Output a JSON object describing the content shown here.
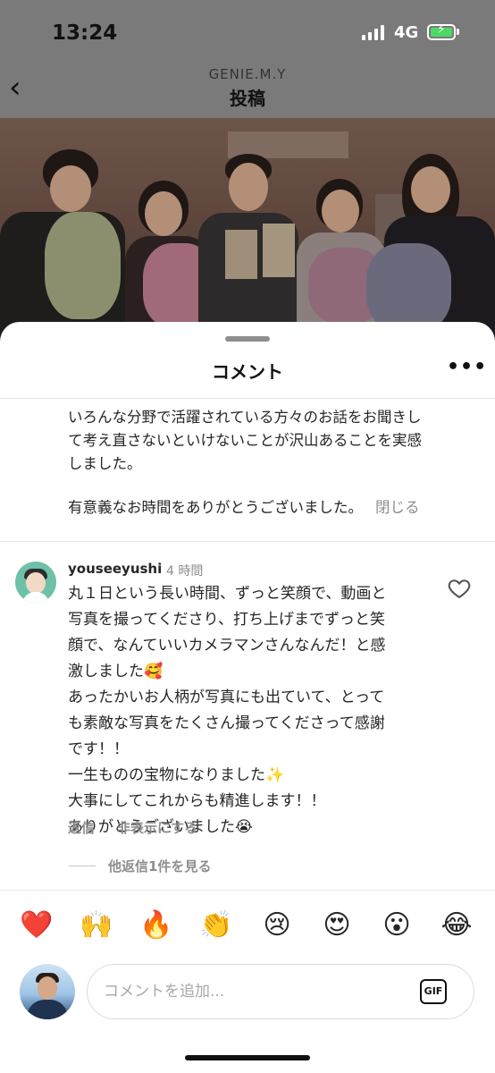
{
  "status": {
    "time": "13:24",
    "network": "4G"
  },
  "header": {
    "account": "GENIE.M.Y",
    "title": "投稿"
  },
  "sheet": {
    "title": "コメント"
  },
  "previous_comment": {
    "line1": "いろんな分野で活躍されている方々のお話をお聞きし",
    "line2": "て考え直さないといけないことが沢山あることを実感",
    "line3": "しました。",
    "line4": "有意義なお時間をありがとうございました。",
    "close_label": "閉じる"
  },
  "comment": {
    "username": "youseeyushi",
    "time": "4 時間",
    "lines": [
      "丸１日という長い時間、ずっと笑顔で、動画と",
      "写真を撮ってくださり、打ち上げまでずっと笑",
      "顔で、なんていいカメラマンさんなんだ！と感",
      "激しました🥰",
      "あったかいお人柄が写真にも出ていて、とって",
      "も素敵な写真をたくさん撮ってくださって感謝",
      "です！！",
      "一生ものの宝物になりました✨",
      "大事にしてこれからも精進します！！",
      "ありがとうございました😭"
    ],
    "reply_label": "返信",
    "hide_label": "非表示にする",
    "view_replies_label": "他返信1件を見る"
  },
  "emojis": [
    "❤️",
    "🙌",
    "🔥",
    "👏",
    "😢",
    "😍",
    "😮",
    "😂"
  ],
  "composer": {
    "placeholder": "コメントを追加...",
    "gif_label": "GIF"
  },
  "icons": {
    "back": "chevron-left-icon",
    "more": "more-horizontal-icon",
    "like": "heart-outline-icon",
    "gif": "gif-icon"
  },
  "colors": {
    "muted": "#8e8e8e",
    "text": "#262626",
    "avatar_ring": "#6fc0a8"
  }
}
